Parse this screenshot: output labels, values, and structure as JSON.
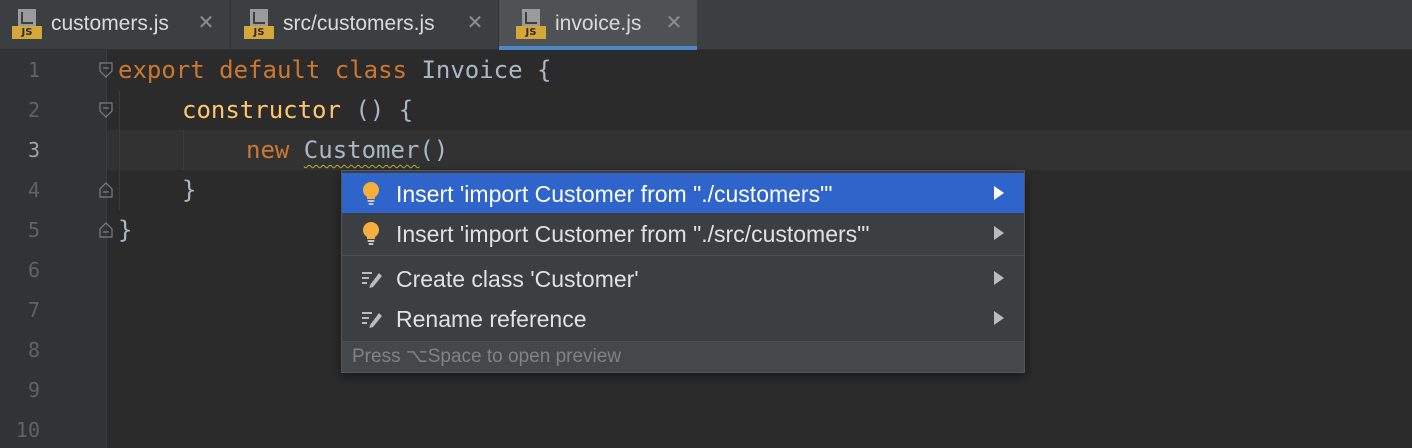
{
  "tabs": [
    {
      "icon": "js-file-icon",
      "badge": "JS",
      "label": "customers.js",
      "active": false
    },
    {
      "icon": "js-file-icon",
      "badge": "JS",
      "label": "src/customers.js",
      "active": false
    },
    {
      "icon": "js-file-icon",
      "badge": "JS",
      "label": "invoice.js",
      "active": true
    }
  ],
  "close_glyph": "✕",
  "gutter": {
    "line_numbers": [
      "1",
      "2",
      "3",
      "4",
      "5",
      "6",
      "7",
      "8",
      "9",
      "10"
    ],
    "current_line": "3"
  },
  "code": {
    "l1": {
      "kw": "export default class ",
      "rest": "Invoice {"
    },
    "l2": {
      "fn": "constructor",
      "rest": " () {"
    },
    "l3": {
      "kw": "new ",
      "err": "Customer",
      "rest": "()"
    },
    "l4": {
      "rest": "}"
    },
    "l5": {
      "rest": "}"
    }
  },
  "popup": {
    "items": [
      {
        "icon": "lightbulb-icon",
        "label": "Insert 'import Customer from \"./customers\"'",
        "selected": true
      },
      {
        "icon": "lightbulb-icon",
        "label": "Insert 'import Customer from \"./src/customers\"'",
        "selected": false
      },
      {
        "icon": "quick-fix-pencil-icon",
        "label": "Create class 'Customer'",
        "selected": false
      },
      {
        "icon": "quick-fix-pencil-icon",
        "label": "Rename reference",
        "selected": false
      }
    ],
    "footer": "Press ⌥Space to open preview"
  },
  "colors": {
    "editor_bg": "#2b2b2b",
    "keyword": "#cc7832",
    "function": "#ffc66d",
    "selection": "#2f65ca",
    "js_badge": "#d5a73a"
  }
}
